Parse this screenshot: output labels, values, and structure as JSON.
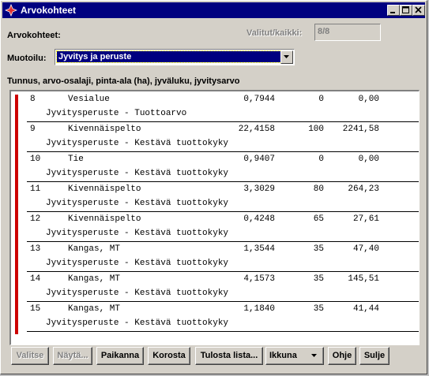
{
  "window": {
    "title": "Arvokohteet"
  },
  "header": {
    "arvokohteet_label": "Arvokohteet:",
    "selected_label": "Valitut/kaikki:",
    "selected_value": "8/8",
    "format_label": "Muotoilu:",
    "format_value": "Jyvitys ja peruste",
    "columns_caption": "Tunnus, arvo-osalaji, pinta-ala (ha), jyväluku, jyvitysarvo"
  },
  "rows": [
    {
      "id": "8",
      "type": "Vesialue",
      "area": "0,7944",
      "jyv": "0",
      "sum": "0,00",
      "basis": "Jyvitysperuste - Tuottoarvo"
    },
    {
      "id": "9",
      "type": "Kivennäispelto",
      "area": "22,4158",
      "jyv": "100",
      "sum": "2241,58",
      "basis": "Jyvitysperuste - Kestävä tuottokyky"
    },
    {
      "id": "10",
      "type": "Tie",
      "area": "0,9407",
      "jyv": "0",
      "sum": "0,00",
      "basis": "Jyvitysperuste - Kestävä tuottokyky"
    },
    {
      "id": "11",
      "type": "Kivennäispelto",
      "area": "3,3029",
      "jyv": "80",
      "sum": "264,23",
      "basis": "Jyvitysperuste - Kestävä tuottokyky"
    },
    {
      "id": "12",
      "type": "Kivennäispelto",
      "area": "0,4248",
      "jyv": "65",
      "sum": "27,61",
      "basis": "Jyvitysperuste - Kestävä tuottokyky"
    },
    {
      "id": "13",
      "type": "Kangas, MT",
      "area": "1,3544",
      "jyv": "35",
      "sum": "47,40",
      "basis": "Jyvitysperuste - Kestävä tuottokyky"
    },
    {
      "id": "14",
      "type": "Kangas, MT",
      "area": "4,1573",
      "jyv": "35",
      "sum": "145,51",
      "basis": "Jyvitysperuste - Kestävä tuottokyky"
    },
    {
      "id": "15",
      "type": "Kangas, MT",
      "area": "1,1840",
      "jyv": "35",
      "sum": "41,44",
      "basis": "Jyvitysperuste - Kestävä tuottokyky"
    }
  ],
  "buttons": {
    "valitse": "Valitse",
    "nayta": "Näytä...",
    "paikanna": "Paikanna",
    "korosta": "Korosta",
    "tulosta": "Tulosta lista...",
    "ikkuna": "Ikkuna",
    "ohje": "Ohje",
    "sulje": "Sulje"
  },
  "colors": {
    "titlebar": "#000080",
    "selection": "#000080",
    "marker": "#cc0000",
    "face": "#d4d0c8"
  }
}
